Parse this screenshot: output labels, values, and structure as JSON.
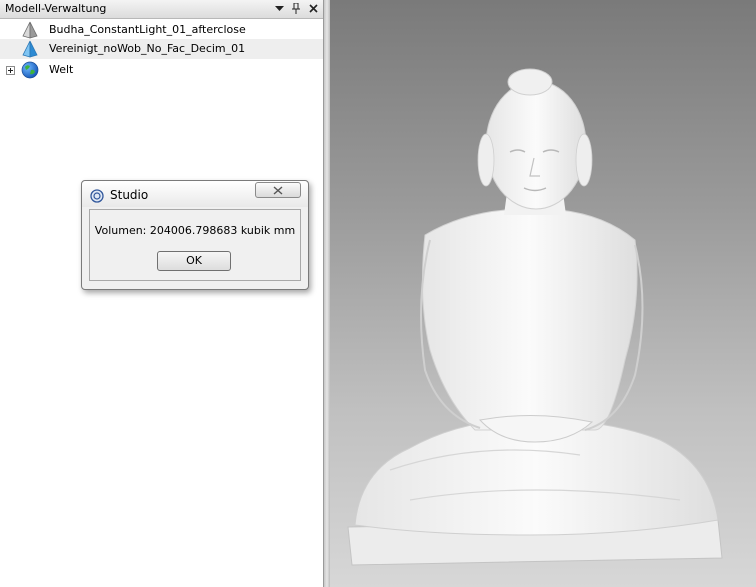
{
  "panel": {
    "title": "Modell-Verwaltung",
    "buttons": {
      "dropdown_icon": "dropdown-arrow-icon",
      "pin_icon": "pin-icon",
      "close_icon": "close-icon"
    },
    "items": [
      {
        "label": "Budha_ConstantLight_01_afterclose",
        "icon": "pyramid-mesh-icon-gray",
        "selected": false
      },
      {
        "label": "Vereinigt_noWob_No_Fac_Decim_01",
        "icon": "pyramid-mesh-icon-blue",
        "selected": true
      },
      {
        "label": "Welt",
        "icon": "globe-icon",
        "expandable": true
      }
    ]
  },
  "dialog": {
    "title": "Studio",
    "message": "Volumen: 204006.798683 kubik mm",
    "ok_label": "OK",
    "close_icon": "close-icon"
  },
  "viewport": {
    "object": "buddha-statue-3d-model"
  }
}
